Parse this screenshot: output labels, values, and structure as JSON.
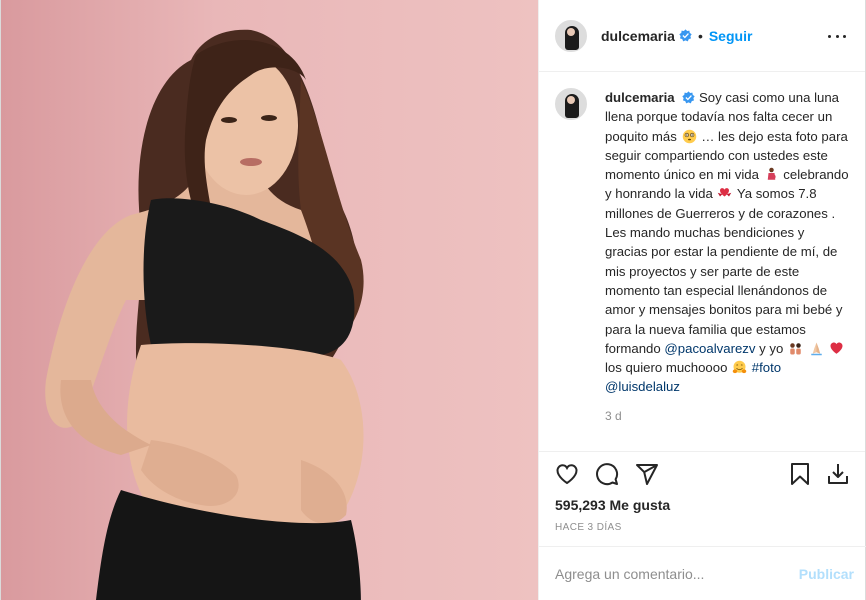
{
  "header": {
    "username": "dulcemaria",
    "separator": "•",
    "follow_label": "Seguir"
  },
  "caption": {
    "username": "dulcemaria",
    "text_1": "Soy casi como una luna llena porque todavía nos falta cecer un poquito más",
    "text_2": "… les dejo esta foto para seguir compartiendo con ustedes este momento único en mi vida",
    "text_3": "celebrando y honrando la vida",
    "text_4": "Ya somos 7.8 millones de Guerreros y de corazones . Les mando muchas bendiciones y gracias por estar la pendiente de mí, de mis proyectos y ser parte de este momento tan especial llenándonos de amor y mensajes bonitos para mi bebé y para la nueva familia que estamos formando",
    "mention_1": "@pacoalvarezv",
    "text_5": "y yo",
    "text_6": "los quiero muchoooo",
    "hashtag": "#foto",
    "mention_2": "@luisdelaluz",
    "time": "3 d"
  },
  "stats": {
    "likes": "595,293 Me gusta",
    "ago": "HACE 3 DÍAS"
  },
  "comment_box": {
    "placeholder": "Agrega un comentario...",
    "publish_label": "Publicar"
  },
  "colors": {
    "accent": "#0095f6",
    "link": "#00376b",
    "muted": "#8e8e8e",
    "publish_disabled": "#b2dffc",
    "photo_bg": "#e9b7b8"
  },
  "icons": [
    "verified-badge-icon",
    "more-options-icon",
    "heart-icon",
    "comment-icon",
    "share-icon",
    "bookmark-icon",
    "download-icon"
  ]
}
